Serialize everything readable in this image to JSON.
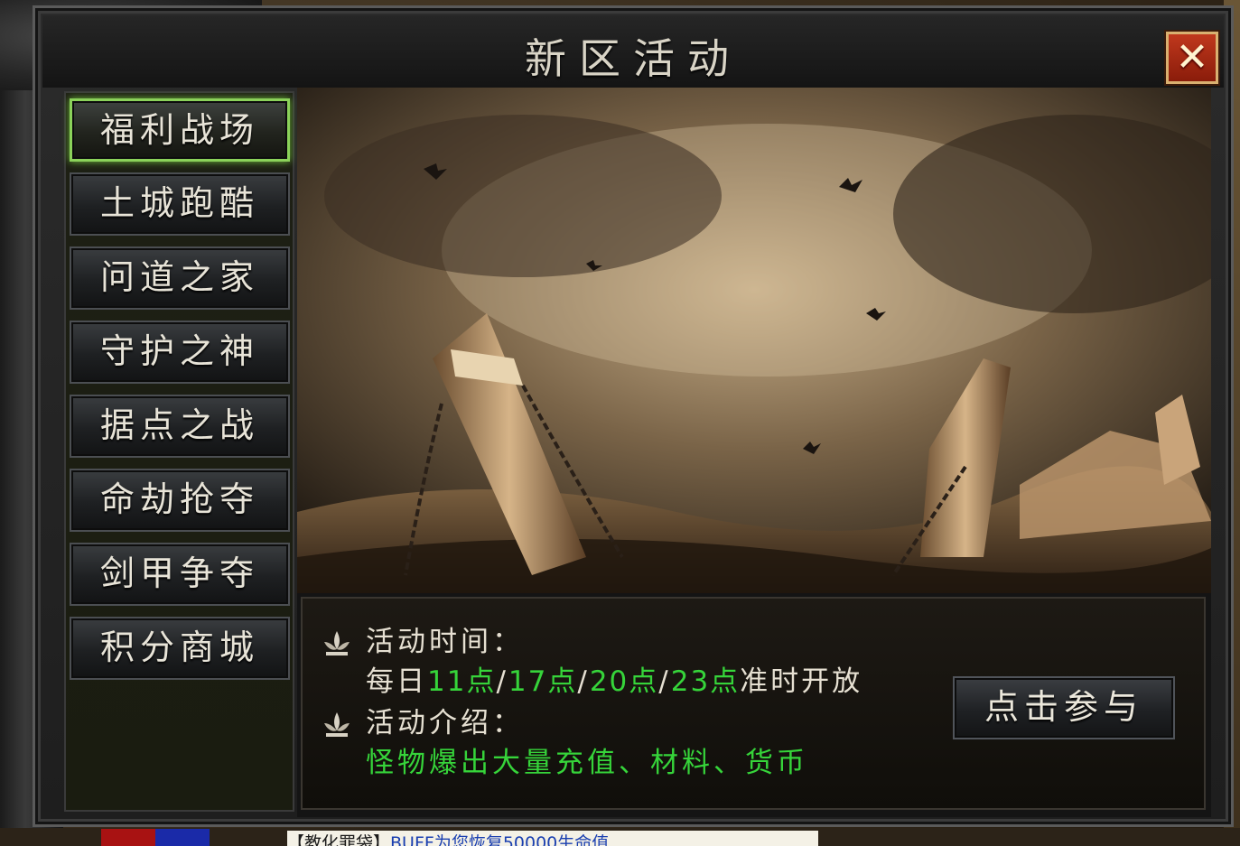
{
  "window": {
    "title": "新区活动",
    "close_label": "✕"
  },
  "nav": {
    "items": [
      {
        "label": "福利战场",
        "active": true
      },
      {
        "label": "土城跑酷",
        "active": false
      },
      {
        "label": "问道之家",
        "active": false
      },
      {
        "label": "守护之神",
        "active": false
      },
      {
        "label": "据点之战",
        "active": false
      },
      {
        "label": "命劫抢夺",
        "active": false
      },
      {
        "label": "剑甲争夺",
        "active": false
      },
      {
        "label": "积分商城",
        "active": false
      }
    ]
  },
  "info": {
    "time_label": "活动时间：",
    "time_prefix": "每日",
    "time_slots": [
      "11点",
      "17点",
      "20点",
      "23点"
    ],
    "time_separator": "/",
    "time_suffix": "准时开放",
    "intro_label": "活动介绍：",
    "intro_text": "怪物爆出大量充值、材料、货币",
    "join_label": "点击参与"
  },
  "chat": {
    "prefix": "【教化罪袋】",
    "text": "BUFF为您恢复50000生命值"
  },
  "colors": {
    "highlight_green": "#36d43a",
    "active_border": "#8bd25a",
    "close_red": "#c0381d"
  }
}
